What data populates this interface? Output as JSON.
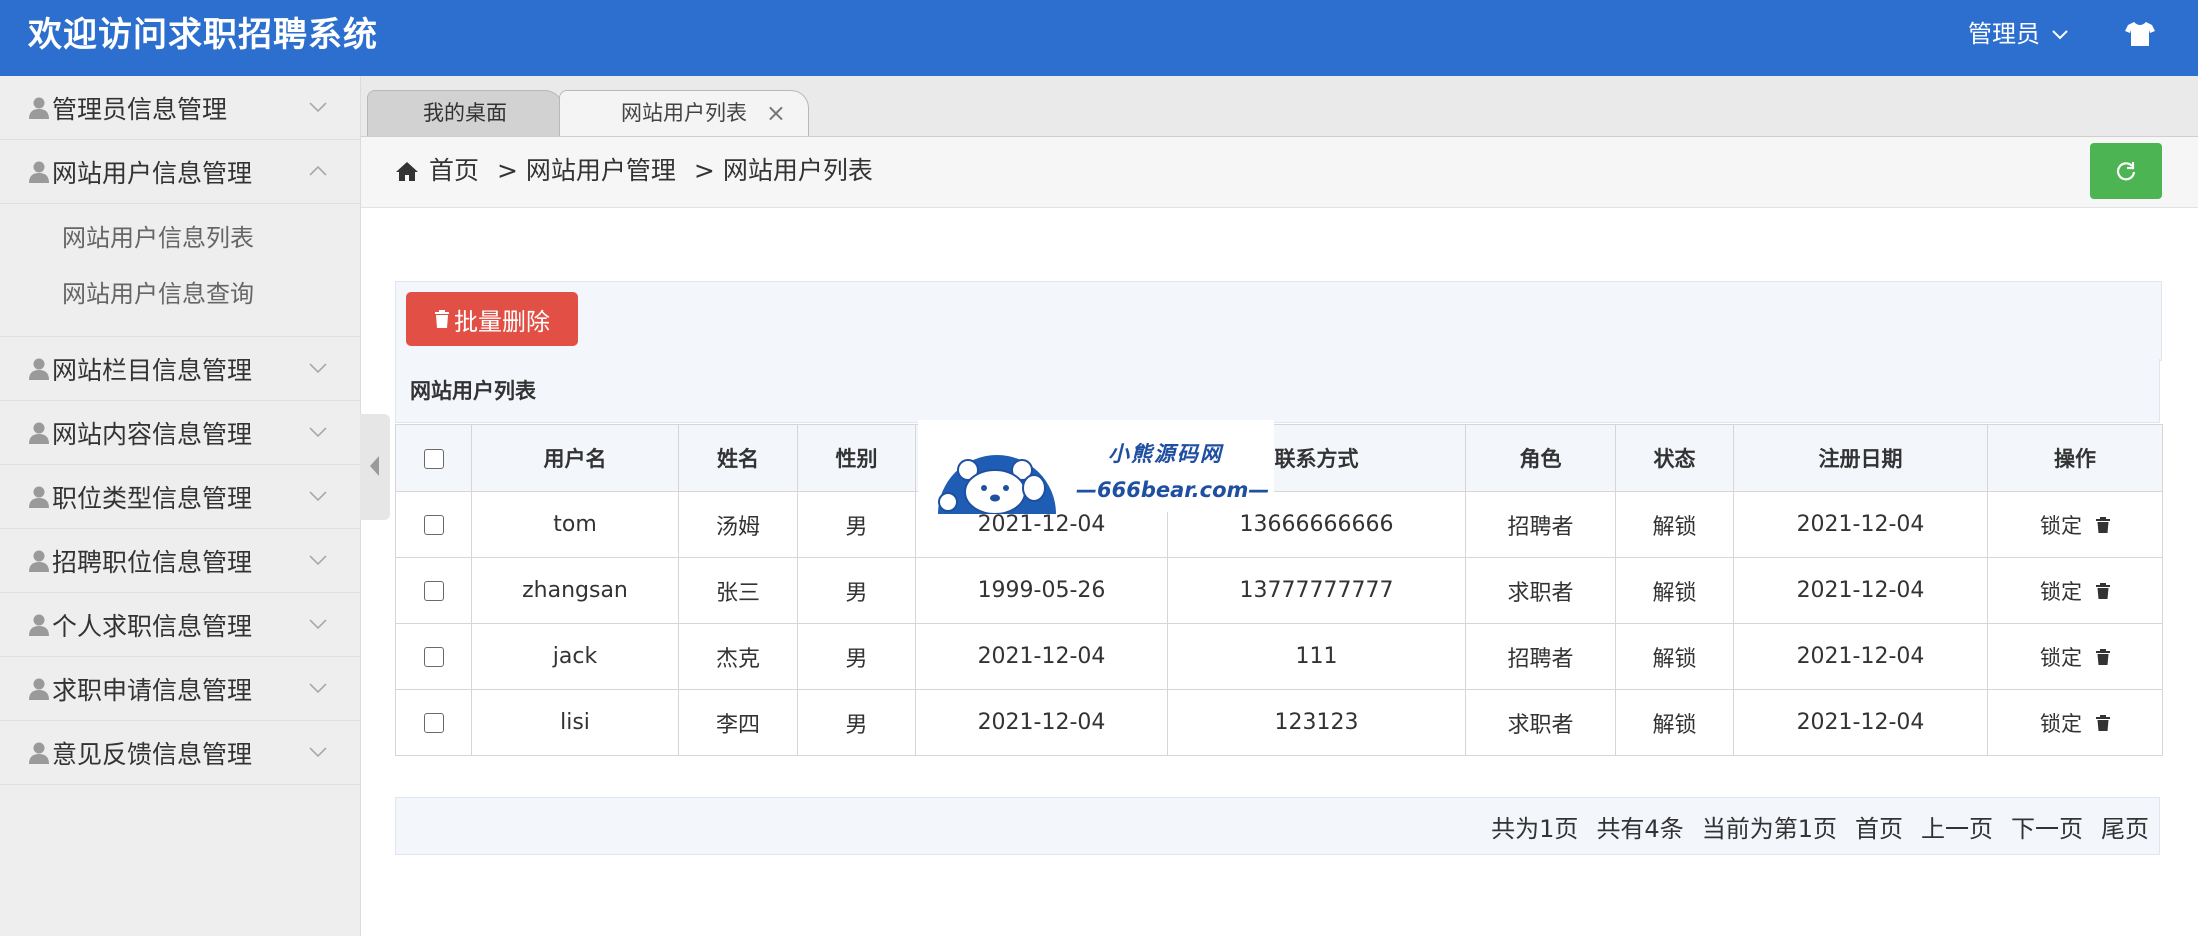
{
  "header": {
    "title": "欢迎访问求职招聘系统",
    "admin_label": "管理员"
  },
  "sidebar": {
    "items": [
      {
        "label": "管理员信息管理"
      },
      {
        "label": "网站用户信息管理"
      },
      {
        "label": "网站栏目信息管理"
      },
      {
        "label": "网站内容信息管理"
      },
      {
        "label": "职位类型信息管理"
      },
      {
        "label": "招聘职位信息管理"
      },
      {
        "label": "个人求职信息管理"
      },
      {
        "label": "求职申请信息管理"
      },
      {
        "label": "意见反馈信息管理"
      }
    ],
    "sub_items": [
      {
        "label": "网站用户信息列表"
      },
      {
        "label": "网站用户信息查询"
      }
    ]
  },
  "tabs": [
    {
      "label": "我的桌面"
    },
    {
      "label": "网站用户列表",
      "close": "×"
    }
  ],
  "breadcrumb": {
    "home": "首页",
    "level1": "> 网站用户管理",
    "level2": "> 网站用户列表"
  },
  "toolbar": {
    "batch_delete_label": "批量删除"
  },
  "panel": {
    "title": "网站用户列表"
  },
  "table": {
    "headers": [
      "用户名",
      "姓名",
      "性别",
      "",
      "联系方式",
      "角色",
      "状态",
      "注册日期",
      "操作"
    ],
    "rows": [
      {
        "username": "tom",
        "name": "汤姆",
        "gender": "男",
        "birth": "2021-12-04",
        "phone": "13666666666",
        "role": "招聘者",
        "status": "解锁",
        "reg_date": "2021-12-04",
        "op": "锁定"
      },
      {
        "username": "zhangsan",
        "name": "张三",
        "gender": "男",
        "birth": "1999-05-26",
        "phone": "13777777777",
        "role": "求职者",
        "status": "解锁",
        "reg_date": "2021-12-04",
        "op": "锁定"
      },
      {
        "username": "jack",
        "name": "杰克",
        "gender": "男",
        "birth": "2021-12-04",
        "phone": "111",
        "role": "招聘者",
        "status": "解锁",
        "reg_date": "2021-12-04",
        "op": "锁定"
      },
      {
        "username": "lisi",
        "name": "李四",
        "gender": "男",
        "birth": "2021-12-04",
        "phone": "123123",
        "role": "求职者",
        "status": "解锁",
        "reg_date": "2021-12-04",
        "op": "锁定"
      }
    ]
  },
  "pager": {
    "total_pages": "共为1页",
    "total_records": "共有4条",
    "current": "当前为第1页",
    "first": "首页",
    "prev": "上一页",
    "next": "下一页",
    "last": "尾页"
  },
  "watermark": {
    "line1": "小熊源码网",
    "line2": "—666bear.com—"
  },
  "colors": {
    "header_bg": "#2d6fce",
    "delete_button": "#e25045",
    "refresh_button": "#4cb452",
    "watermark_text": "#1f4fa0"
  },
  "icons": [
    "user-icon",
    "chevron-down-icon",
    "chevron-up-icon",
    "home-icon",
    "refresh-icon",
    "trash-icon",
    "tshirt-icon",
    "bear-logo-icon"
  ]
}
